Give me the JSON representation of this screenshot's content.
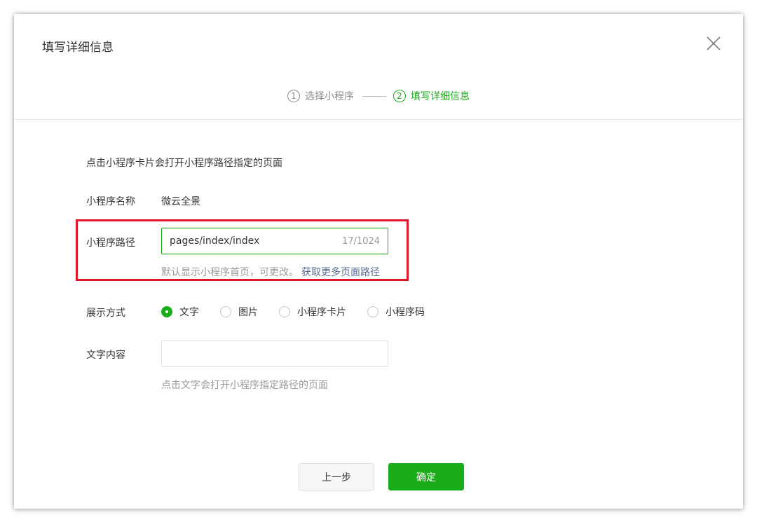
{
  "dialog": {
    "title": "填写详细信息"
  },
  "steps": [
    {
      "num": "1",
      "label": "选择小程序"
    },
    {
      "num": "2",
      "label": "填写详细信息"
    }
  ],
  "form": {
    "top_hint": "点击小程序卡片会打开小程序路径指定的页面",
    "name_label": "小程序名称",
    "name_value": "微云全景",
    "path_label": "小程序路径",
    "path_value": "pages/index/index",
    "path_count": "17/1024",
    "path_hint": "默认显示小程序首页，可更改。",
    "path_link": "获取更多页面路径",
    "display_label": "展示方式",
    "display_options": [
      "文字",
      "图片",
      "小程序卡片",
      "小程序码"
    ],
    "display_selected": "文字",
    "text_label": "文字内容",
    "text_value": "",
    "text_hint": "点击文字会打开小程序指定路径的页面"
  },
  "buttons": {
    "prev": "上一步",
    "ok": "确定"
  },
  "colors": {
    "accent": "#1aad19",
    "highlight": "#e0162b",
    "link": "#576b95"
  },
  "icons": {
    "close": "close-icon"
  }
}
